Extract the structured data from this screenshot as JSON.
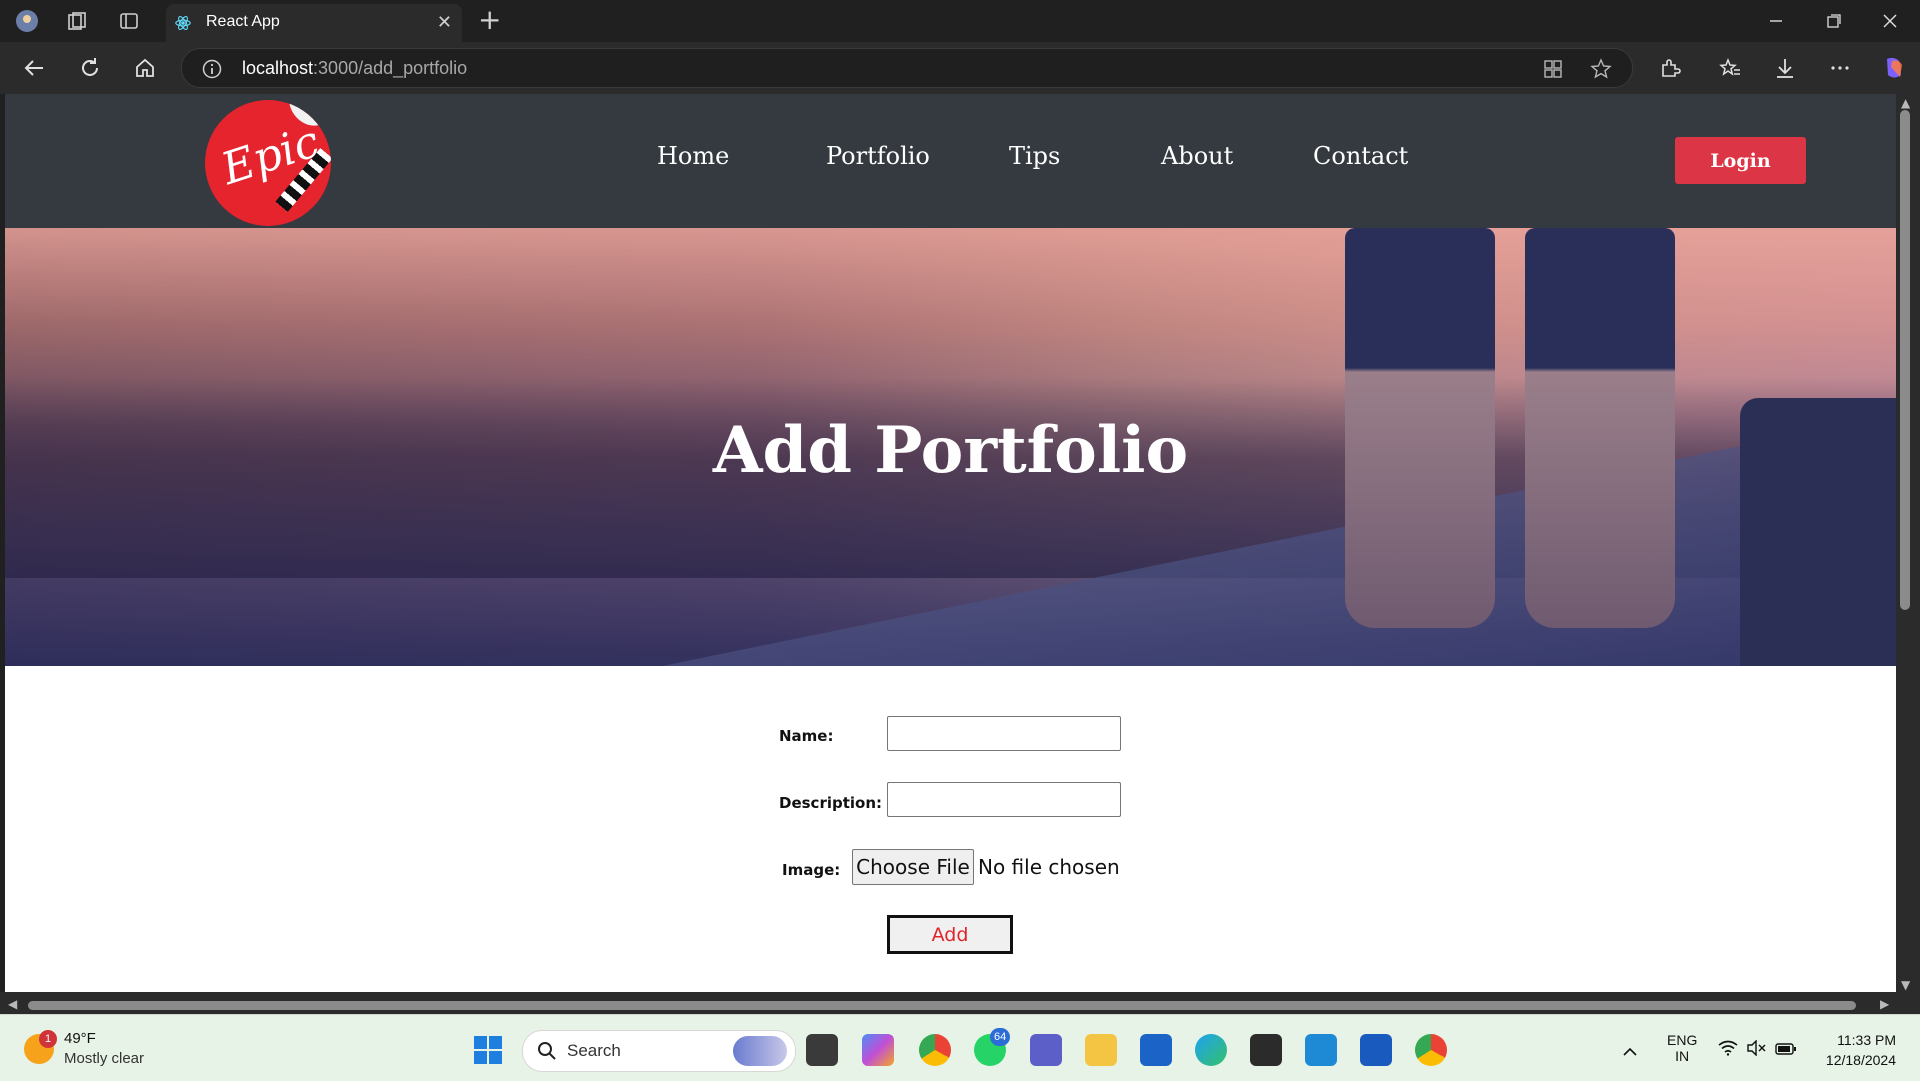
{
  "browser": {
    "tab_title": "React App",
    "url_host": "localhost",
    "url_path": ":3000/add_portfolio",
    "new_tab_symbol": "+",
    "tab_close_symbol": "✕"
  },
  "site": {
    "logo_text": "Epic",
    "nav": [
      {
        "label": "Home"
      },
      {
        "label": "Portfolio"
      },
      {
        "label": "Tips"
      },
      {
        "label": "About"
      },
      {
        "label": "Contact"
      }
    ],
    "login_label": "Login"
  },
  "hero": {
    "title": "Add Portfolio"
  },
  "form": {
    "name_label": "Name:",
    "description_label": "Description:",
    "image_label": "Image:",
    "choose_file_label": "Choose File",
    "file_status": "No file chosen",
    "submit_label": "Add"
  },
  "taskbar": {
    "weather_temp": "49°F",
    "weather_desc": "Mostly clear",
    "weather_badge": "1",
    "search_placeholder": "Search",
    "whatsapp_badge": "64",
    "lang_top": "ENG",
    "lang_bottom": "IN",
    "time": "11:33 PM",
    "date": "12/18/2024"
  },
  "colors": {
    "header_bg": "#343a40",
    "login_bg": "#dc3545",
    "add_text": "#e0242d",
    "logo_red": "#e5242d"
  }
}
